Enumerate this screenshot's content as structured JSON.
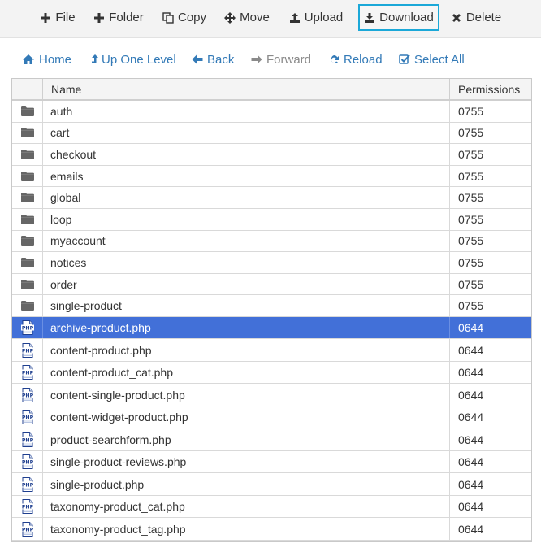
{
  "toolbar": {
    "buttons": [
      {
        "id": "file",
        "label": "File",
        "icon": "plus-icon"
      },
      {
        "id": "folder",
        "label": "Folder",
        "icon": "plus-icon"
      },
      {
        "id": "copy",
        "label": "Copy",
        "icon": "copy-icon"
      },
      {
        "id": "move",
        "label": "Move",
        "icon": "move-arrows-icon"
      },
      {
        "id": "upload",
        "label": "Upload",
        "icon": "upload-icon"
      },
      {
        "id": "download",
        "label": "Download",
        "icon": "download-icon"
      },
      {
        "id": "delete",
        "label": "Delete",
        "icon": "close-x-icon"
      }
    ]
  },
  "navbar": {
    "home": "Home",
    "up_one_level": "Up One Level",
    "back": "Back",
    "forward": "Forward",
    "reload": "Reload",
    "select_all": "Select All"
  },
  "table": {
    "columns": {
      "name": "Name",
      "permissions": "Permissions"
    },
    "rows": [
      {
        "type": "folder",
        "name": "auth",
        "permissions": "0755"
      },
      {
        "type": "folder",
        "name": "cart",
        "permissions": "0755"
      },
      {
        "type": "folder",
        "name": "checkout",
        "permissions": "0755"
      },
      {
        "type": "folder",
        "name": "emails",
        "permissions": "0755"
      },
      {
        "type": "folder",
        "name": "global",
        "permissions": "0755"
      },
      {
        "type": "folder",
        "name": "loop",
        "permissions": "0755"
      },
      {
        "type": "folder",
        "name": "myaccount",
        "permissions": "0755"
      },
      {
        "type": "folder",
        "name": "notices",
        "permissions": "0755"
      },
      {
        "type": "folder",
        "name": "order",
        "permissions": "0755"
      },
      {
        "type": "folder",
        "name": "single-product",
        "permissions": "0755"
      },
      {
        "type": "php",
        "name": "archive-product.php",
        "permissions": "0644",
        "selected": true
      },
      {
        "type": "php",
        "name": "content-product.php",
        "permissions": "0644"
      },
      {
        "type": "php",
        "name": "content-product_cat.php",
        "permissions": "0644"
      },
      {
        "type": "php",
        "name": "content-single-product.php",
        "permissions": "0644"
      },
      {
        "type": "php",
        "name": "content-widget-product.php",
        "permissions": "0644"
      },
      {
        "type": "php",
        "name": "product-searchform.php",
        "permissions": "0644"
      },
      {
        "type": "php",
        "name": "single-product-reviews.php",
        "permissions": "0644"
      },
      {
        "type": "php",
        "name": "single-product.php",
        "permissions": "0644"
      },
      {
        "type": "php",
        "name": "taxonomy-product_cat.php",
        "permissions": "0644"
      },
      {
        "type": "php",
        "name": "taxonomy-product_tag.php",
        "permissions": "0644"
      }
    ]
  },
  "colors": {
    "selected_row": "#4270d8",
    "link_blue": "#337ab7",
    "active_button_border": "#1ba8d8"
  }
}
